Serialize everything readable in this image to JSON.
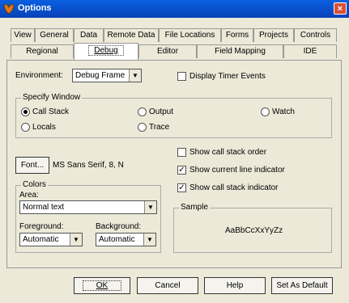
{
  "window": {
    "title": "Options",
    "close_symbol": "×"
  },
  "tabs_back": [
    {
      "label": "View"
    },
    {
      "label": "General"
    },
    {
      "label": "Data"
    },
    {
      "label": "Remote Data"
    },
    {
      "label": "File Locations"
    },
    {
      "label": "Forms"
    },
    {
      "label": "Projects"
    },
    {
      "label": "Controls"
    }
  ],
  "tabs_front": [
    {
      "label": "Regional"
    },
    {
      "label": "Debug",
      "active": true
    },
    {
      "label": "Editor"
    },
    {
      "label": "Field Mapping"
    },
    {
      "label": "IDE"
    }
  ],
  "environment": {
    "label": "Environment:",
    "value": "Debug Frame"
  },
  "display_timer_events": {
    "label": "Display Timer Events",
    "checked": false
  },
  "specify_window": {
    "title": "Specify Window",
    "options": [
      {
        "label": "Call Stack",
        "selected": true
      },
      {
        "label": "Output",
        "selected": false
      },
      {
        "label": "Watch",
        "selected": false
      },
      {
        "label": "Locals",
        "selected": false
      },
      {
        "label": "Trace",
        "selected": false
      }
    ]
  },
  "font": {
    "button_label": "Font...",
    "value": "MS Sans Serif, 8, N"
  },
  "checks": [
    {
      "label": "Show call stack order",
      "checked": false
    },
    {
      "label": "Show current line indicator",
      "checked": true
    },
    {
      "label": "Show call stack indicator",
      "checked": true
    }
  ],
  "colors": {
    "title": "Colors",
    "area_label": "Area:",
    "area_value": "Normal text",
    "foreground_label": "Foreground:",
    "foreground_value": "Automatic",
    "background_label": "Background:",
    "background_value": "Automatic"
  },
  "sample": {
    "title": "Sample",
    "text": "AaBbCcXxYyZz"
  },
  "buttons": {
    "ok": "OK",
    "cancel": "Cancel",
    "help": "Help",
    "set_default": "Set As Default"
  },
  "colors_ui": {
    "titlebar": "#0a5fe0",
    "dialog_bg": "#ece9d8",
    "close": "#d8503a"
  }
}
